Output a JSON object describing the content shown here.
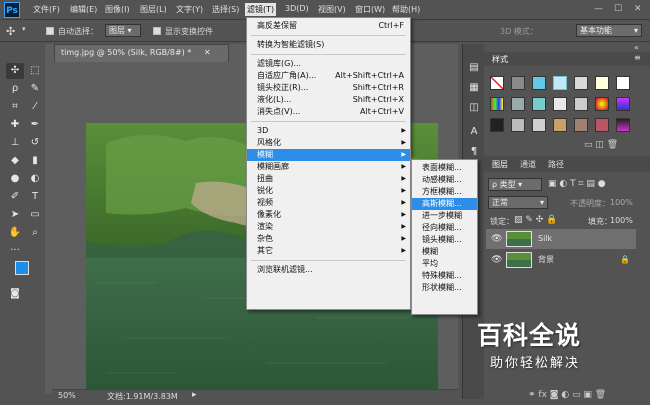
{
  "app": {
    "logo": "Ps"
  },
  "menubar": {
    "items": [
      "文件(F)",
      "编辑(E)",
      "图像(I)",
      "图层(L)",
      "文字(Y)",
      "选择(S)",
      "滤镜(T)",
      "3D(D)",
      "视图(V)",
      "窗口(W)",
      "帮助(H)"
    ],
    "active_index": 6
  },
  "window_controls": {
    "minimize": "—",
    "maximize": "☐",
    "close": "✕"
  },
  "options_bar": {
    "auto_select_label": "自动选择：",
    "auto_select_value": "图层",
    "show_transform_label": "显示变换控件",
    "mode_3d_label": "3D 模式：",
    "workspace": "基本功能"
  },
  "document": {
    "tab_title": "timg.jpg @ 50% (Silk, RGB/8#) *",
    "close": "✕",
    "zoom": "50%",
    "doc_size": "文档:1.91M/3.83M",
    "status_arrow": "▸"
  },
  "filter_menu": {
    "items": [
      {
        "label": "高反差保留",
        "shortcut": "Ctrl+F"
      },
      {
        "sep": true
      },
      {
        "label": "转换为智能滤镜(S)"
      },
      {
        "sep": true
      },
      {
        "label": "滤镜库(G)..."
      },
      {
        "label": "自适应广角(A)...",
        "shortcut": "Alt+Shift+Ctrl+A"
      },
      {
        "label": "镜头校正(R)...",
        "shortcut": "Shift+Ctrl+R"
      },
      {
        "label": "液化(L)...",
        "shortcut": "Shift+Ctrl+X"
      },
      {
        "label": "消失点(V)...",
        "shortcut": "Alt+Ctrl+V"
      },
      {
        "sep": true
      },
      {
        "label": "3D",
        "sub": true
      },
      {
        "label": "风格化",
        "sub": true
      },
      {
        "label": "模糊",
        "sub": true,
        "highlight": true
      },
      {
        "label": "模糊画廊",
        "sub": true
      },
      {
        "label": "扭曲",
        "sub": true
      },
      {
        "label": "锐化",
        "sub": true
      },
      {
        "label": "视频",
        "sub": true
      },
      {
        "label": "像素化",
        "sub": true
      },
      {
        "label": "渲染",
        "sub": true
      },
      {
        "label": "杂色",
        "sub": true
      },
      {
        "label": "其它",
        "sub": true
      },
      {
        "sep": true
      },
      {
        "label": "浏览联机滤镜..."
      }
    ]
  },
  "blur_submenu": {
    "items": [
      {
        "label": "表面模糊..."
      },
      {
        "label": "动感模糊..."
      },
      {
        "label": "方框模糊..."
      },
      {
        "label": "高斯模糊...",
        "highlight": true
      },
      {
        "label": "进一步模糊"
      },
      {
        "label": "径向模糊..."
      },
      {
        "label": "镜头模糊..."
      },
      {
        "label": "模糊"
      },
      {
        "label": "平均"
      },
      {
        "label": "特殊模糊..."
      },
      {
        "label": "形状模糊..."
      }
    ]
  },
  "styles_panel": {
    "tab": "样式",
    "menu": "≡",
    "collapse": "«"
  },
  "layers_panel": {
    "tabs": [
      "图层",
      "通道",
      "路径"
    ],
    "filter_label": "ρ 类型",
    "blend_mode": "正常",
    "opacity_label": "不透明度：",
    "opacity_value": "100%",
    "lock_label": "锁定：",
    "fill_label": "填充：",
    "fill_value": "100%",
    "layers": [
      {
        "name": "Silk",
        "selected": true
      },
      {
        "name": "背景",
        "locked": true
      }
    ]
  },
  "watermark": {
    "main": "百科全说",
    "sub": "助你轻松解决"
  }
}
